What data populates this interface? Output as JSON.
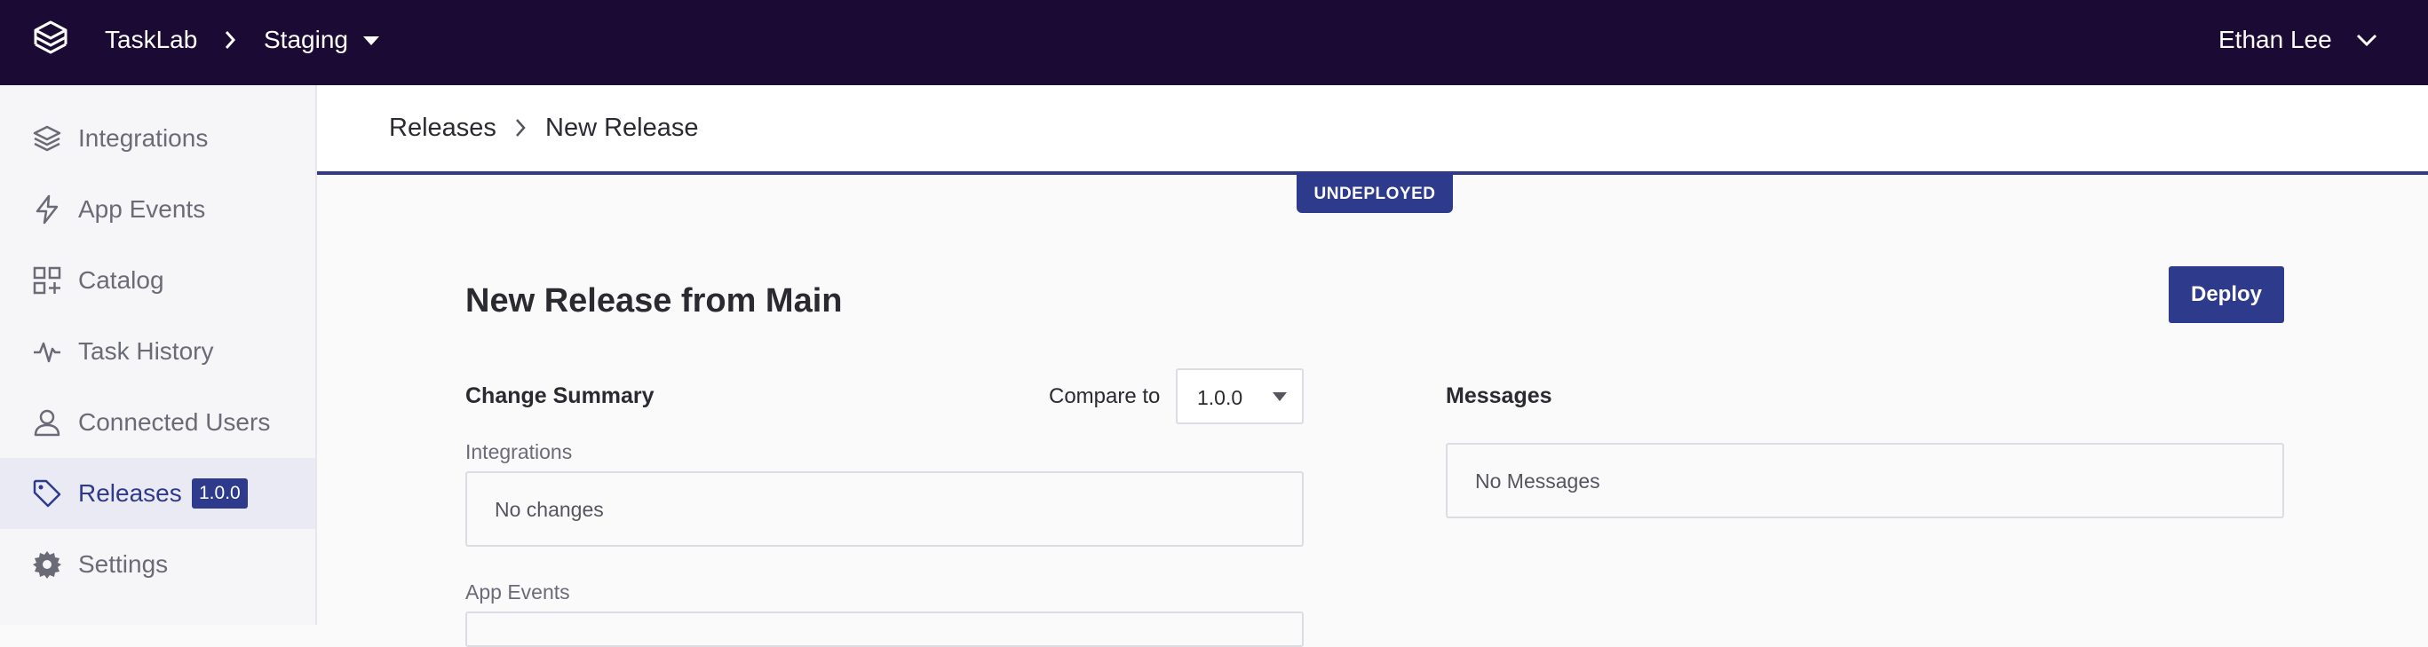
{
  "topbar": {
    "app_name": "TaskLab",
    "environment": "Staging",
    "user_name": "Ethan Lee",
    "background": "#1b0a33"
  },
  "sidebar": {
    "items": [
      {
        "label": "Integrations",
        "icon": "layers-icon"
      },
      {
        "label": "App Events",
        "icon": "lightning-icon"
      },
      {
        "label": "Catalog",
        "icon": "grid-plus-icon"
      },
      {
        "label": "Task History",
        "icon": "activity-icon"
      },
      {
        "label": "Connected Users",
        "icon": "user-icon"
      },
      {
        "label": "Releases",
        "icon": "tag-icon",
        "badge": "1.0.0",
        "active": true
      },
      {
        "label": "Settings",
        "icon": "gear-icon"
      }
    ]
  },
  "page": {
    "breadcrumb": [
      "Releases",
      "New Release"
    ],
    "status": "UNDEPLOYED",
    "title": "New Release from Main",
    "deploy_label": "Deploy"
  },
  "change_summary": {
    "title": "Change Summary",
    "compare_label": "Compare to",
    "compare_value": "1.0.0",
    "integrations_label": "Integrations",
    "integrations_value": "No changes",
    "app_events_label": "App Events"
  },
  "messages": {
    "title": "Messages",
    "value": "No Messages"
  },
  "colors": {
    "accent": "#2e3a8c",
    "topbar": "#1b0a33"
  }
}
